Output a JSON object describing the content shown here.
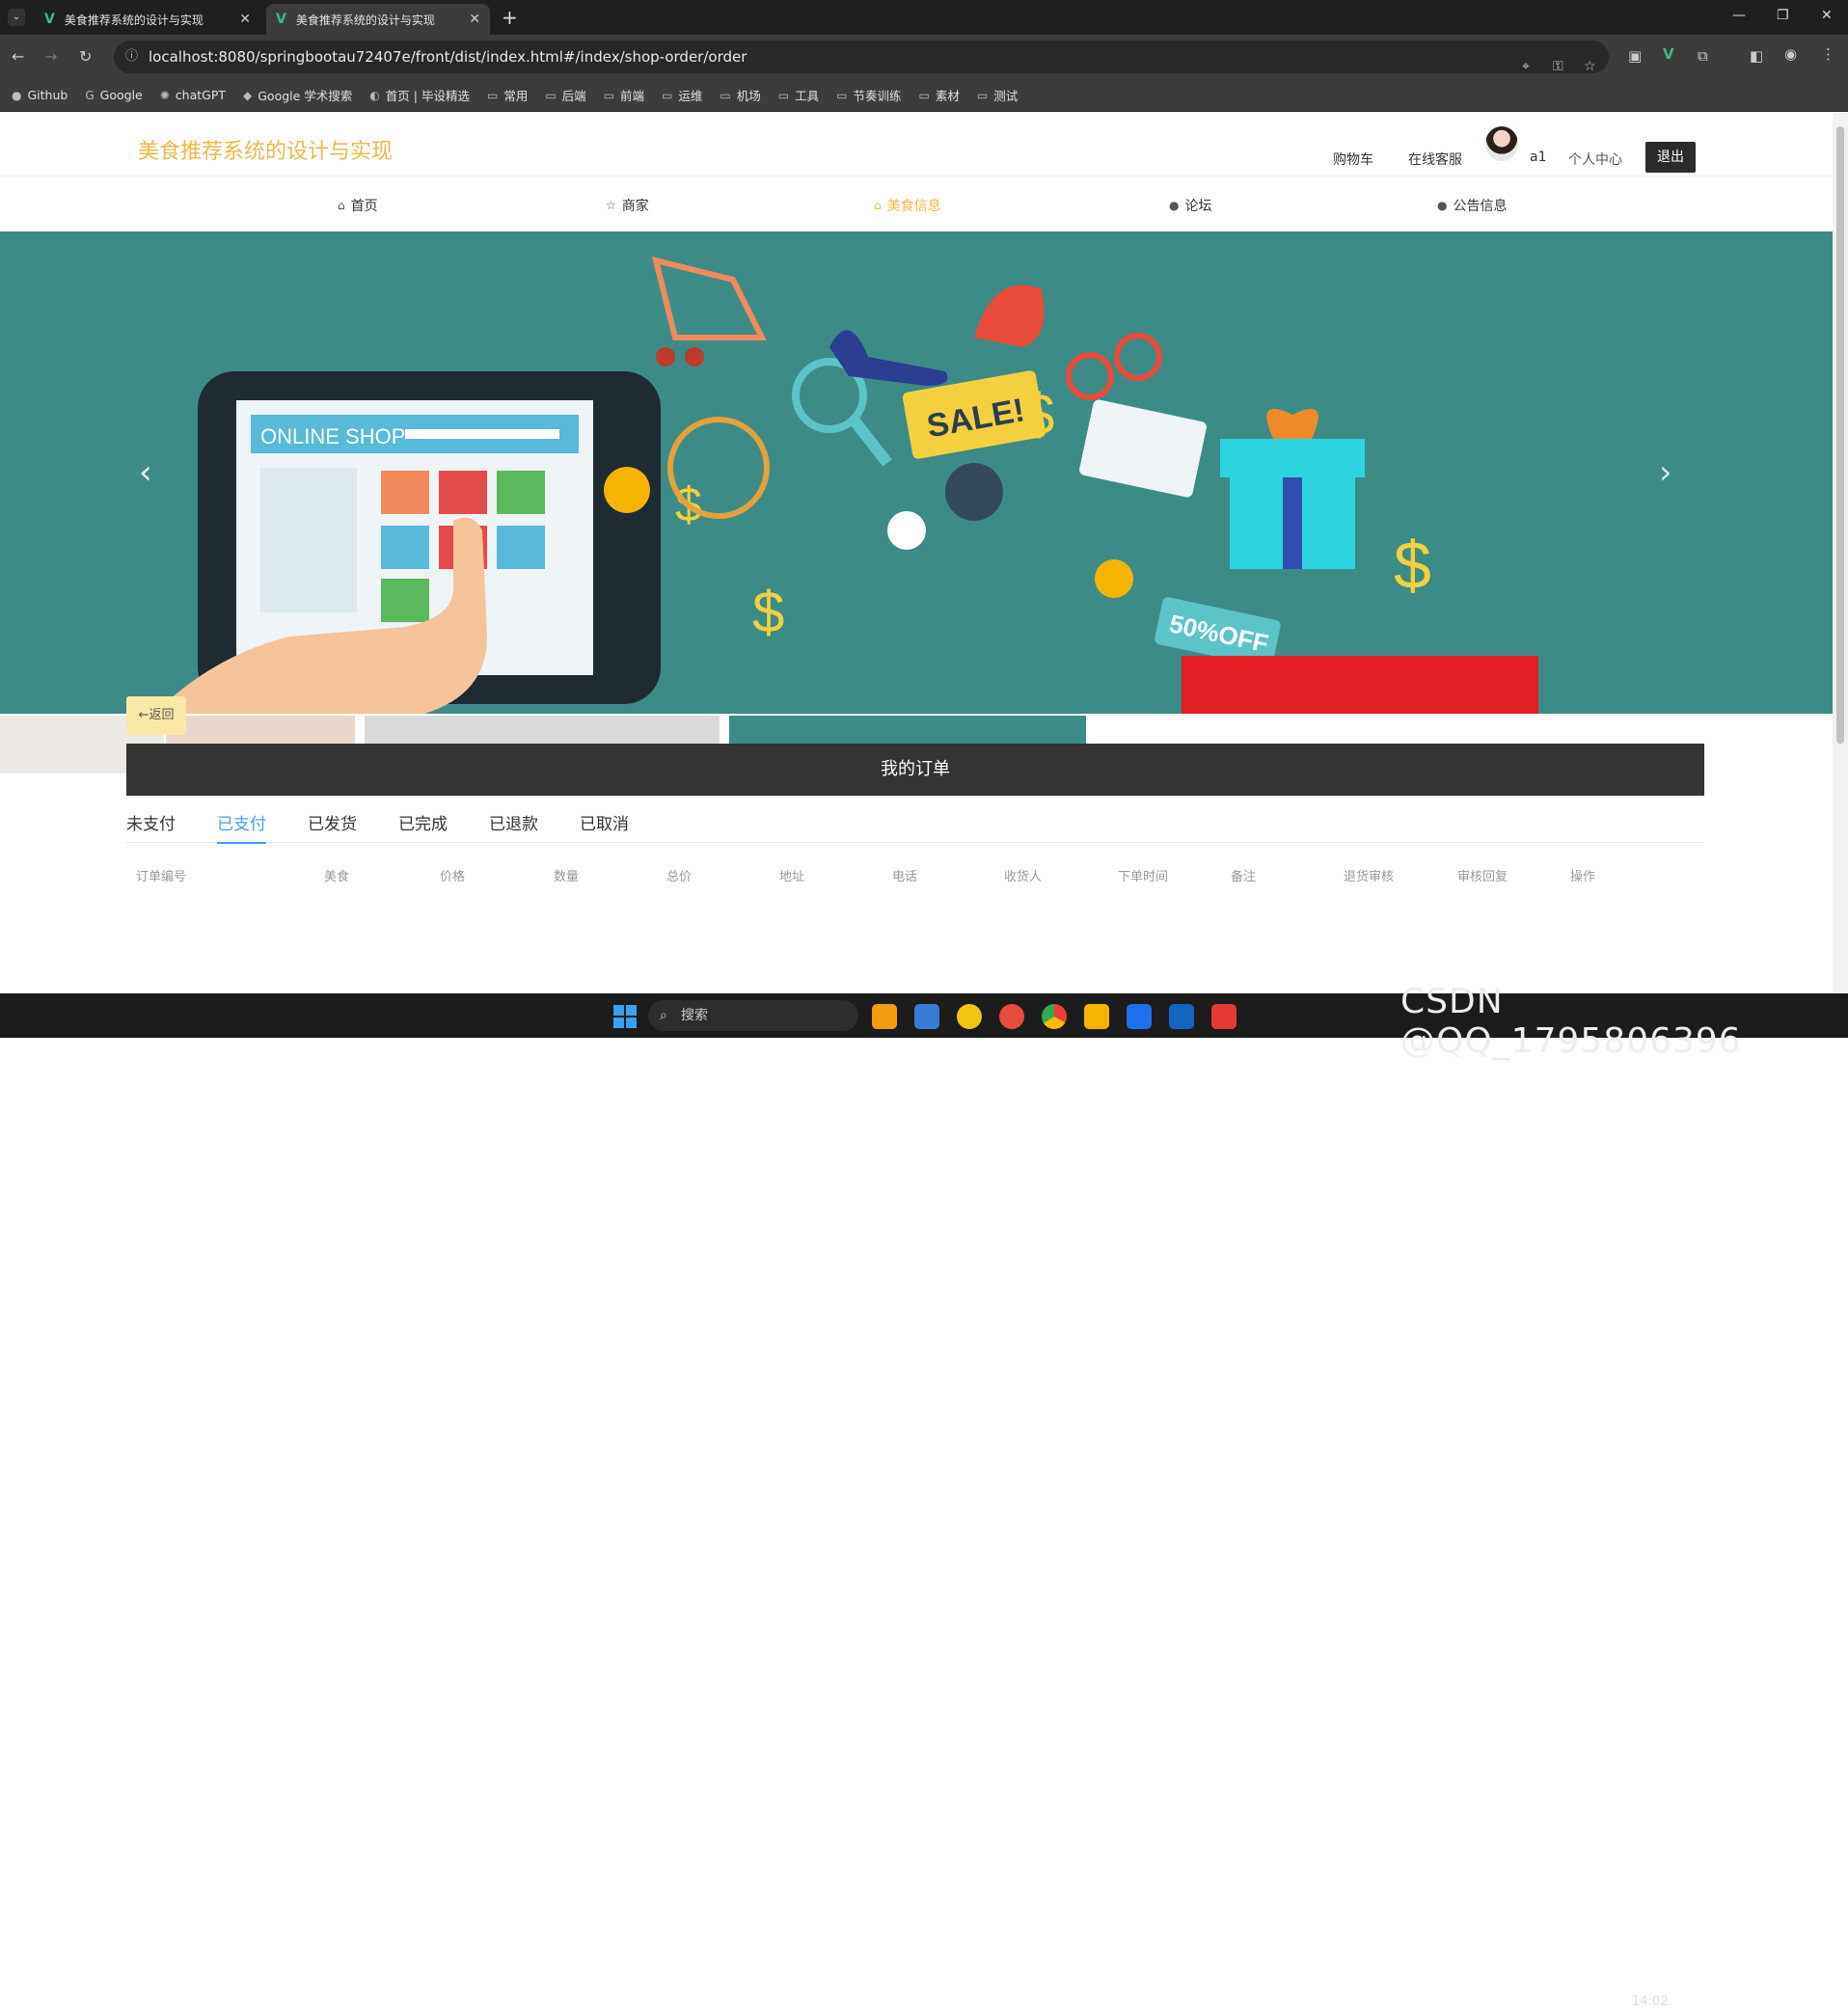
{
  "browser": {
    "tabs": [
      {
        "title": "美食推荐系统的设计与实现"
      },
      {
        "title": "美食推荐系统的设计与实现"
      }
    ],
    "url": "localhost:8080/springbootau72407e/front/dist/index.html#/index/shop-order/order",
    "bookmarks": [
      "Github",
      "Google",
      "chatGPT",
      "Google 学术搜索",
      "首页 | 毕设精选",
      "常用",
      "后端",
      "前端",
      "运维",
      "机场",
      "工具",
      "节奏训练",
      "素材",
      "测试"
    ]
  },
  "site": {
    "title": "美食推荐系统的设计与实现",
    "header_links": [
      "购物车",
      "在线客服"
    ],
    "username": "a1",
    "user_center": "个人中心",
    "logout": "退出",
    "nav": [
      {
        "label": "首页",
        "icon": "home-icon"
      },
      {
        "label": "商家",
        "icon": "star-icon"
      },
      {
        "label": "美食信息",
        "icon": "bag-icon",
        "active": true
      },
      {
        "label": "论坛",
        "icon": "info-icon"
      },
      {
        "label": "公告信息",
        "icon": "help-icon"
      }
    ]
  },
  "banner": {
    "texts": [
      "ONLINE SHOP",
      "SALE!",
      "50%OFF"
    ]
  },
  "orders": {
    "back": "←返回",
    "title": "我的订单",
    "tabs": [
      "未支付",
      "已支付",
      "已发货",
      "已完成",
      "已退款",
      "已取消"
    ],
    "active_tab": "已支付",
    "columns": [
      "订单编号",
      "美食",
      "价格",
      "数量",
      "总价",
      "地址",
      "电话",
      "收货人",
      "下单时间",
      "备注",
      "退货审核",
      "审核回复",
      "操作"
    ]
  },
  "taskbar": {
    "search": "搜索",
    "time": "14:02"
  },
  "watermark": "CSDN @QQ_1795806396",
  "colors": {
    "accent": "#f0b74b",
    "tab_active": "#409eff",
    "banner_bg": "#3d8b87"
  }
}
